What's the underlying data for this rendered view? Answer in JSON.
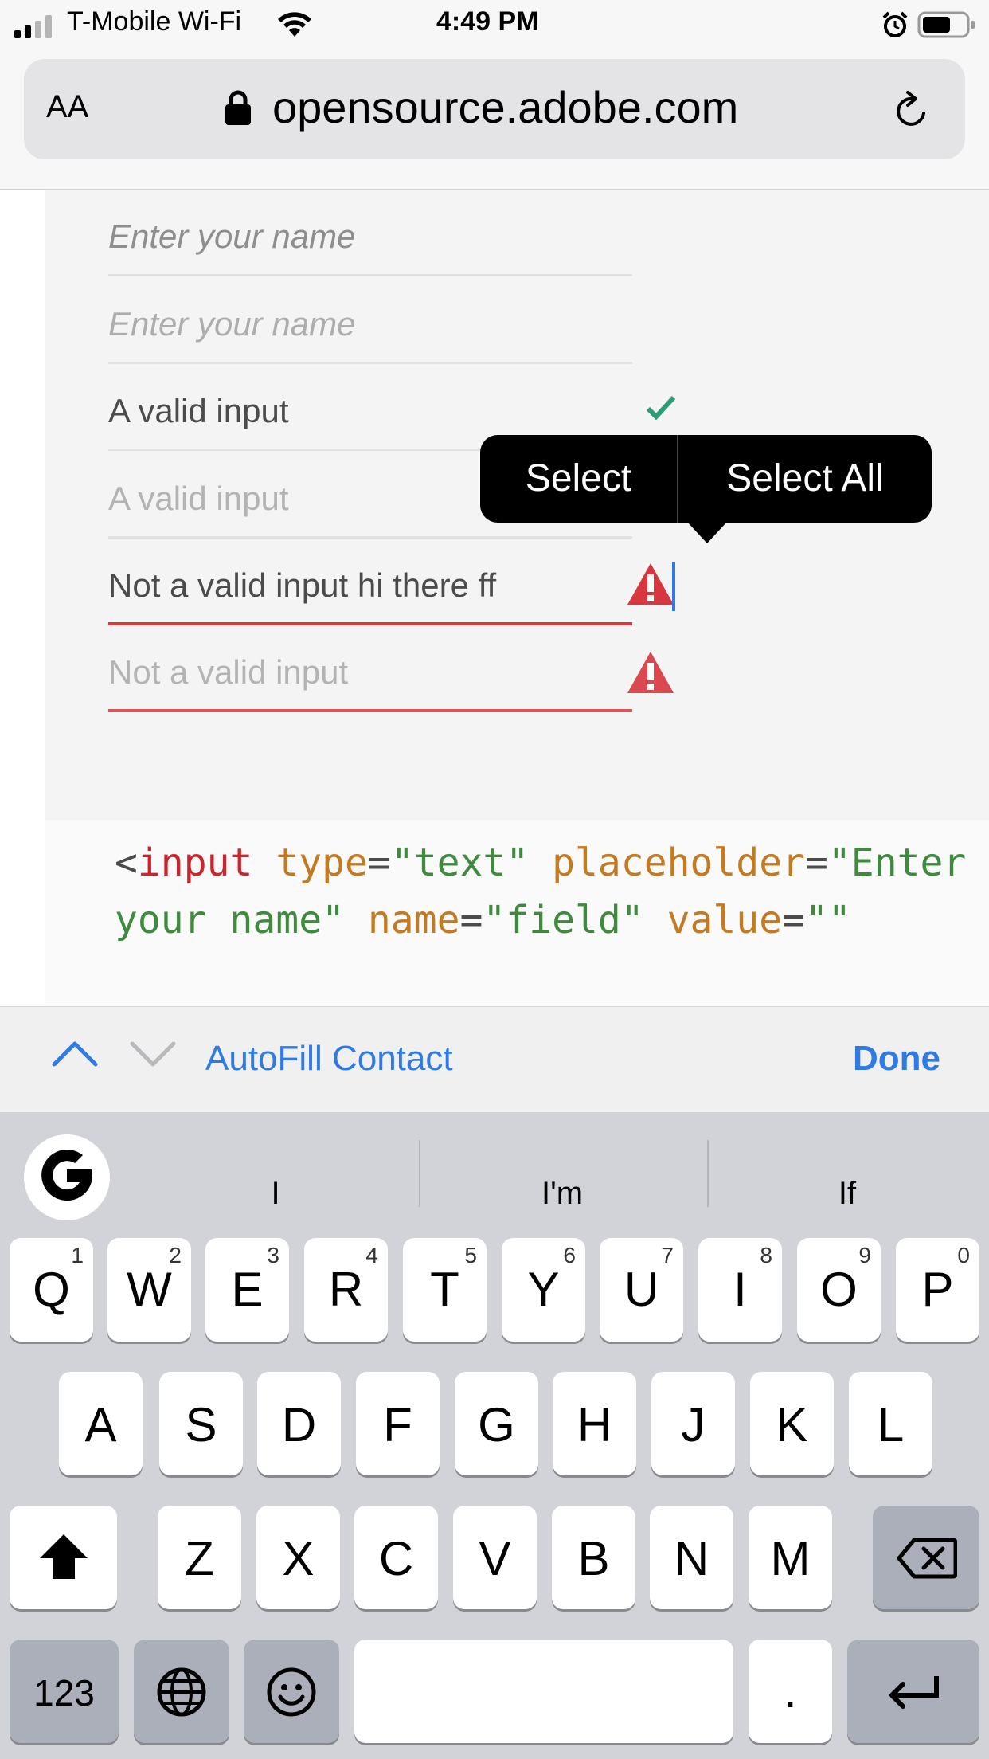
{
  "status_bar": {
    "carrier": "T-Mobile Wi-Fi",
    "time": "4:49 PM"
  },
  "url_bar": {
    "text_size_button": "AA",
    "domain": "opensource.adobe.com"
  },
  "form_fields": [
    {
      "value": "Enter your name",
      "state": "placeholder"
    },
    {
      "value": "Enter your name",
      "state": "placeholder-disabled"
    },
    {
      "value": "A valid input",
      "state": "valid"
    },
    {
      "value": "A valid input",
      "state": "valid-disabled"
    },
    {
      "value": "Not a valid input hi there ff",
      "state": "invalid-focused"
    },
    {
      "value": "Not a valid input",
      "state": "invalid-disabled"
    }
  ],
  "context_menu": {
    "select": "Select",
    "select_all": "Select All"
  },
  "code": {
    "line1": {
      "lt": "<",
      "tag": "input",
      "a1": "type",
      "eq": "=",
      "v1": "\"text\"",
      "a2": "placeholder",
      "v2": "\"Enter"
    },
    "line2": {
      "v2b": "your name\"",
      "a3": "name",
      "v3": "\"field\"",
      "a4": "value",
      "v4": "\"\""
    }
  },
  "accessory_bar": {
    "autofill": "AutoFill Contact",
    "done": "Done"
  },
  "keyboard": {
    "suggestions": [
      "I",
      "I'm",
      "If"
    ],
    "row1": [
      {
        "letter": "Q",
        "num": "1"
      },
      {
        "letter": "W",
        "num": "2"
      },
      {
        "letter": "E",
        "num": "3"
      },
      {
        "letter": "R",
        "num": "4"
      },
      {
        "letter": "T",
        "num": "5"
      },
      {
        "letter": "Y",
        "num": "6"
      },
      {
        "letter": "U",
        "num": "7"
      },
      {
        "letter": "I",
        "num": "8"
      },
      {
        "letter": "O",
        "num": "9"
      },
      {
        "letter": "P",
        "num": "0"
      }
    ],
    "row2": [
      "A",
      "S",
      "D",
      "F",
      "G",
      "H",
      "J",
      "K",
      "L"
    ],
    "row3": [
      "Z",
      "X",
      "C",
      "V",
      "B",
      "N",
      "M"
    ],
    "numbers_key": "123",
    "period_key": "."
  },
  "colors": {
    "link_blue": "#2f7ae5",
    "error_red": "#d7373f",
    "valid_green": "#2d9d78"
  }
}
